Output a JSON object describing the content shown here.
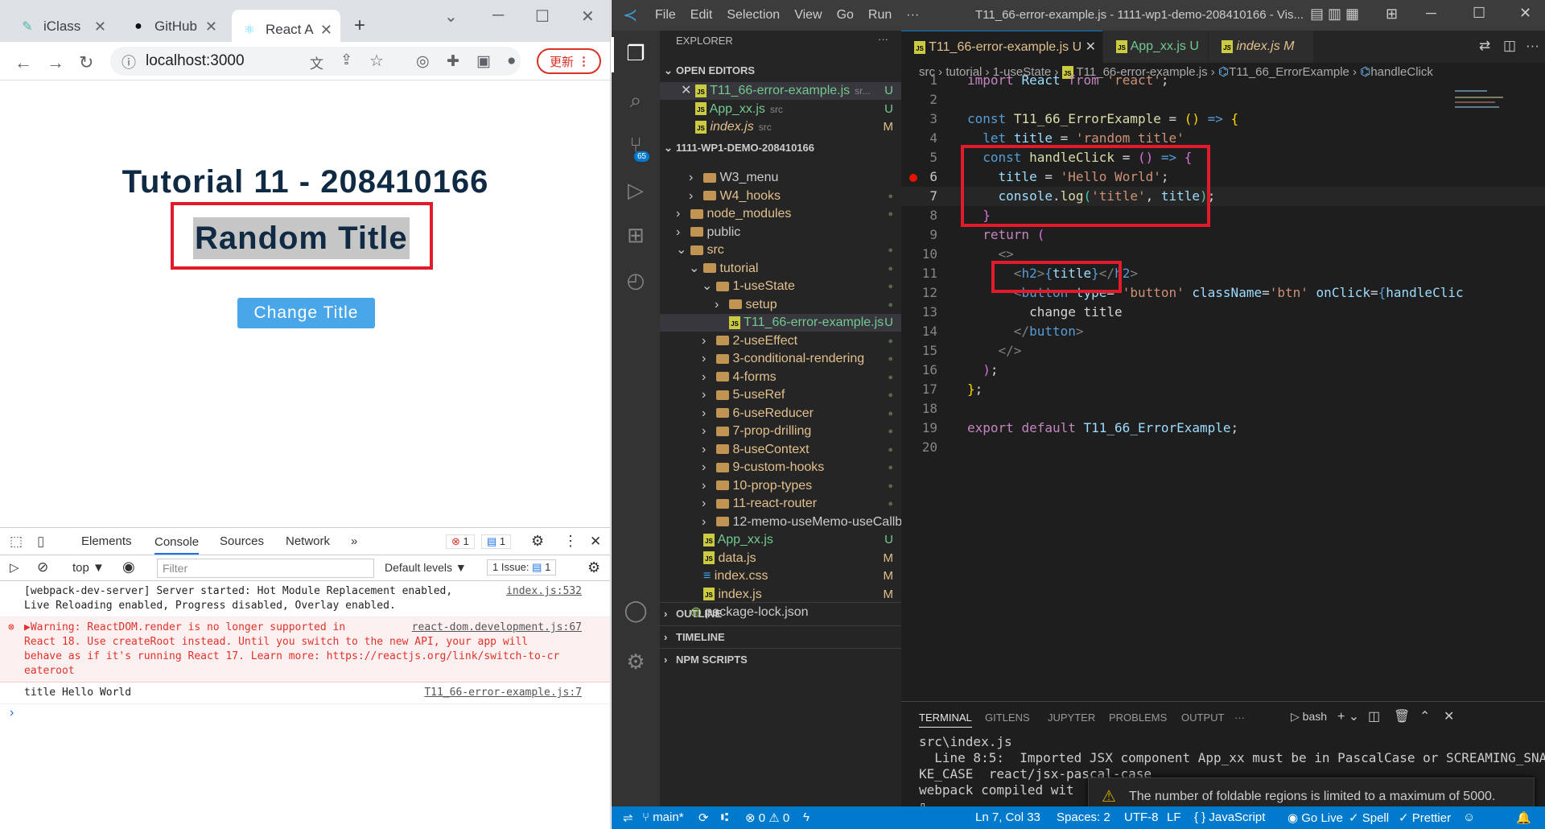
{
  "chrome": {
    "tabs": [
      {
        "label": "iClass",
        "icon": "iclass-icon"
      },
      {
        "label": "GitHub",
        "icon": "github-icon"
      },
      {
        "label": "React A",
        "icon": "react-icon"
      }
    ],
    "new_tab": "+",
    "url": "localhost:3000",
    "update_label": "更新",
    "page": {
      "title": "Tutorial 11 - 208410166",
      "subtitle": "Random Title",
      "button": "Change Title"
    },
    "devtools": {
      "tabs": [
        "Elements",
        "Console",
        "Sources",
        "Network"
      ],
      "more": "»",
      "errors": "1",
      "messages": "1",
      "context": "top ▼",
      "filter_placeholder": "Filter",
      "levels": "Default levels ▼",
      "issues": "1 Issue:",
      "issues_count": "1",
      "lines": [
        {
          "text": "[webpack-dev-server] Server started: Hot Module Replacement enabled,\nLive Reloading enabled, Progress disabled, Overlay enabled.",
          "src": "index.js:532",
          "type": "log"
        },
        {
          "text": "▶Warning: ReactDOM.render is no longer supported in\nReact 18. Use createRoot instead. Until you switch to the new API, your app will\nbehave as if it's running React 17. Learn more: https://reactjs.org/link/switch-to-cr\neateroot",
          "src": "react-dom.development.js:67",
          "type": "error"
        },
        {
          "text": "title Hello World",
          "src": "T11_66-error-example.js:7",
          "type": "log"
        }
      ],
      "prompt": "›"
    }
  },
  "vscode": {
    "menu": [
      "File",
      "Edit",
      "Selection",
      "View",
      "Go",
      "Run",
      "···"
    ],
    "title": "T11_66-error-example.js - 1111-wp1-demo-208410166 - Vis...",
    "explorer_label": "EXPLORER",
    "open_editors_label": "OPEN EDITORS",
    "open_editors": [
      {
        "name": "T11_66-error-example.js",
        "hint": "sr...",
        "status": "U"
      },
      {
        "name": "App_xx.js",
        "hint": "src",
        "status": "U"
      },
      {
        "name": "index.js",
        "hint": "src",
        "status": "M"
      }
    ],
    "project_label": "1111-WP1-DEMO-208410166",
    "tree": [
      {
        "name": "W3_menu",
        "depth": 1,
        "kind": "folder",
        "status": "",
        "arrow": "›"
      },
      {
        "name": "W4_hooks",
        "depth": 1,
        "kind": "folder",
        "status": "●",
        "arrow": "›"
      },
      {
        "name": "node_modules",
        "depth": 0,
        "kind": "folder",
        "status": "●",
        "arrow": "›"
      },
      {
        "name": "public",
        "depth": 0,
        "kind": "folder",
        "status": "",
        "arrow": "›"
      },
      {
        "name": "src",
        "depth": 0,
        "kind": "folder",
        "status": "●",
        "arrow": "⌄"
      },
      {
        "name": "tutorial",
        "depth": 1,
        "kind": "folder",
        "status": "●",
        "arrow": "⌄"
      },
      {
        "name": "1-useState",
        "depth": 2,
        "kind": "folder",
        "status": "●",
        "arrow": "⌄"
      },
      {
        "name": "setup",
        "depth": 3,
        "kind": "folder",
        "status": "●",
        "arrow": "›"
      },
      {
        "name": "T11_66-error-example.js",
        "depth": 3,
        "kind": "js",
        "status": "U",
        "arrow": ""
      },
      {
        "name": "2-useEffect",
        "depth": 2,
        "kind": "folder",
        "status": "●",
        "arrow": "›"
      },
      {
        "name": "3-conditional-rendering",
        "depth": 2,
        "kind": "folder",
        "status": "●",
        "arrow": "›"
      },
      {
        "name": "4-forms",
        "depth": 2,
        "kind": "folder",
        "status": "●",
        "arrow": "›"
      },
      {
        "name": "5-useRef",
        "depth": 2,
        "kind": "folder",
        "status": "●",
        "arrow": "›"
      },
      {
        "name": "6-useReducer",
        "depth": 2,
        "kind": "folder",
        "status": "●",
        "arrow": "›"
      },
      {
        "name": "7-prop-drilling",
        "depth": 2,
        "kind": "folder",
        "status": "●",
        "arrow": "›"
      },
      {
        "name": "8-useContext",
        "depth": 2,
        "kind": "folder",
        "status": "●",
        "arrow": "›"
      },
      {
        "name": "9-custom-hooks",
        "depth": 2,
        "kind": "folder",
        "status": "●",
        "arrow": "›"
      },
      {
        "name": "10-prop-types",
        "depth": 2,
        "kind": "folder",
        "status": "●",
        "arrow": "›"
      },
      {
        "name": "11-react-router",
        "depth": 2,
        "kind": "folder",
        "status": "●",
        "arrow": "›"
      },
      {
        "name": "12-memo-useMemo-useCallb...",
        "depth": 2,
        "kind": "folder",
        "status": "",
        "arrow": "›"
      },
      {
        "name": "App_xx.js",
        "depth": 1,
        "kind": "js",
        "status": "U",
        "arrow": ""
      },
      {
        "name": "data.js",
        "depth": 1,
        "kind": "js",
        "status": "M",
        "arrow": ""
      },
      {
        "name": "index.css",
        "depth": 1,
        "kind": "css",
        "status": "M",
        "arrow": ""
      },
      {
        "name": "index.js",
        "depth": 1,
        "kind": "js",
        "status": "M",
        "arrow": ""
      },
      {
        "name": "package-lock.json",
        "depth": 0,
        "kind": "json",
        "status": "",
        "arrow": ""
      }
    ],
    "outline_label": "OUTLINE",
    "timeline_label": "TIMELINE",
    "npm_label": "NPM SCRIPTS",
    "badge": "65",
    "editor_tabs": [
      {
        "name": "T11_66-error-example.js",
        "status": "U"
      },
      {
        "name": "App_xx.js",
        "status": "U"
      },
      {
        "name": "index.js",
        "status": "M"
      }
    ],
    "breadcrumb": [
      "src",
      "tutorial",
      "1-useState",
      "T11_66-error-example.js",
      "T11_66_ErrorExample",
      "handleClick"
    ],
    "terminal_tabs": [
      "TERMINAL",
      "GITLENS",
      "JUPYTER",
      "PROBLEMS",
      "OUTPUT",
      "···"
    ],
    "terminal_shell": "bash",
    "terminal_lines": [
      "src\\index.js",
      "  Line 8:5:  Imported JSX component App_xx must be in PascalCase or SCREAMING_SNA",
      "KE_CASE  react/jsx-pascal-case",
      "",
      "webpack compiled wit",
      "▯"
    ],
    "notification": "The number of foldable regions is limited to a maximum of 5000. Incre...",
    "status": {
      "branch": "main*",
      "problems": "⊗ 0 ⚠ 0",
      "position": "Ln 7, Col 33",
      "spaces": "Spaces: 2",
      "encoding": "UTF-8",
      "eol": "LF",
      "language": "{ } JavaScript",
      "golive": "Go Live",
      "spell": "✓ Spell",
      "prettier": "✓ Prettier"
    }
  }
}
